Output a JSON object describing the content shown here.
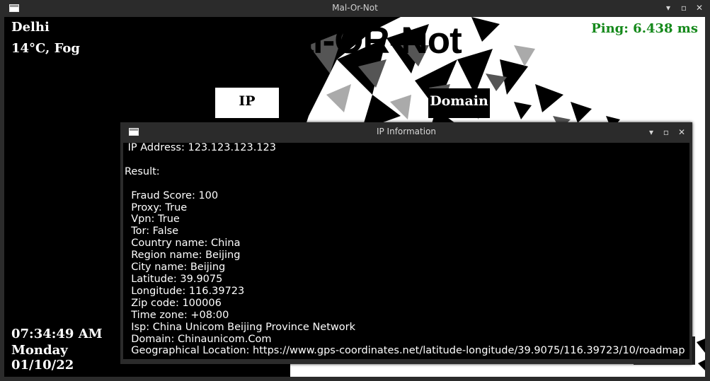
{
  "window": {
    "title": "Mal-Or-Not",
    "minimize_glyph": "▾",
    "maximize_glyph": "▫",
    "close_glyph": "✕"
  },
  "app": {
    "heading": "Mal-OR-Not",
    "location": "Delhi",
    "weather": "14°C, Fog",
    "ping": "Ping: 6.438 ms",
    "time": "07:34:49 AM",
    "day": "Monday",
    "date": "01/10/22",
    "ip_button": "IP",
    "domain_button": "Domain"
  },
  "dialog": {
    "title": "IP Information",
    "lines": [
      " IP Address: 123.123.123.123",
      "",
      "Result:",
      "",
      "  Fraud Score: 100",
      "  Proxy: True",
      "  Vpn: True",
      "  Tor: False",
      "  Country name: China",
      "  Region name: Beijing",
      "  City name: Beijing",
      "  Latitude: 39.9075",
      "  Longitude: 116.39723",
      "  Zip code: 100006",
      "  Time zone: +08:00",
      "  Isp: China Unicom Beijing Province Network",
      "  Domain: Chinaunicom.Com",
      "  Geographical Location: https://www.gps-coordinates.net/latitude-longitude/39.9075/116.39723/10/roadmap"
    ]
  },
  "colors": {
    "ping": "#15891b",
    "titlebar": "#2b2b2b",
    "panel": "#000000"
  }
}
